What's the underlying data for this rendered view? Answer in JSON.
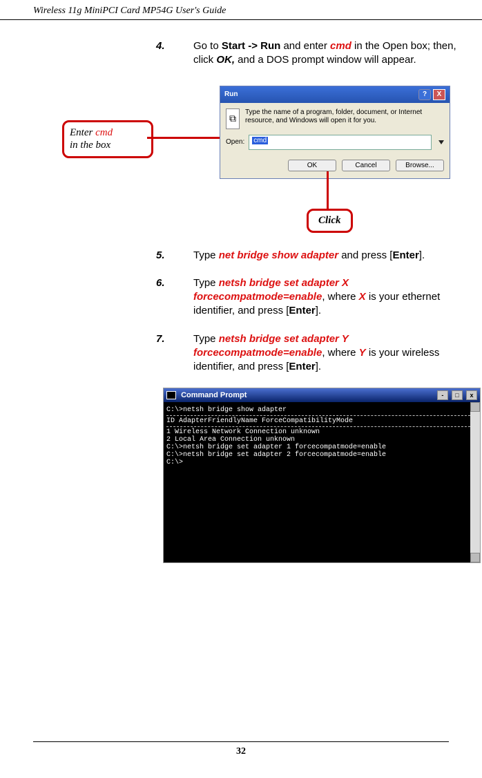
{
  "header": "Wireless 11g MiniPCI Card MP54G User's Guide",
  "steps": {
    "s4": {
      "num": "4.",
      "pre": "Go to ",
      "bold1": "Start -> Run",
      "mid1": " and enter ",
      "cmd": "cmd",
      "mid2": " in the Open box; then, click ",
      "ok": "OK,",
      "post": " and a DOS prompt window will appear."
    },
    "s5": {
      "num": "5.",
      "pre": "Type ",
      "cmd": "net bridge show adapter",
      "mid": " and press [",
      "enter": "Enter",
      "post": "]."
    },
    "s6": {
      "num": "6.",
      "pre": "Type ",
      "cmd": "netsh bridge set adapter X forcecompatmode=enable",
      "mid1": ", where ",
      "x": "X",
      "mid2": " is your ethernet identifier, and press [",
      "enter": "Enter",
      "post": "]."
    },
    "s7": {
      "num": "7.",
      "pre": "Type ",
      "cmd": "netsh bridge set adapter Y forcecompatmode=enable",
      "mid1": ", where ",
      "y": "Y",
      "mid2": " is your wireless identifier, and press [",
      "enter": "Enter",
      "post": "]."
    }
  },
  "callout": {
    "pre": "Enter ",
    "kw": "cmd",
    "post": "in the box"
  },
  "click_label": "Click",
  "run_dialog": {
    "title": "Run",
    "desc": "Type the name of a program, folder, document, or Internet resource, and Windows will open it for you.",
    "open_label": "Open:",
    "input_value": "cmd",
    "ok": "OK",
    "cancel": "Cancel",
    "browse": "Browse..."
  },
  "cmd_window": {
    "title": "Command Prompt",
    "lines": [
      "C:\\>netsh bridge show adapter",
      "",
      " ID AdapterFriendlyName        ForceCompatibilityMode",
      "",
      "  1 Wireless Network Connection unknown",
      "  2 Local Area Connection       unknown",
      "",
      "",
      "C:\\>netsh bridge set adapter 1 forcecompatmode=enable",
      "",
      "C:\\>netsh bridge set adapter 2 forcecompatmode=enable",
      "",
      "C:\\>"
    ]
  },
  "page_number": "32"
}
